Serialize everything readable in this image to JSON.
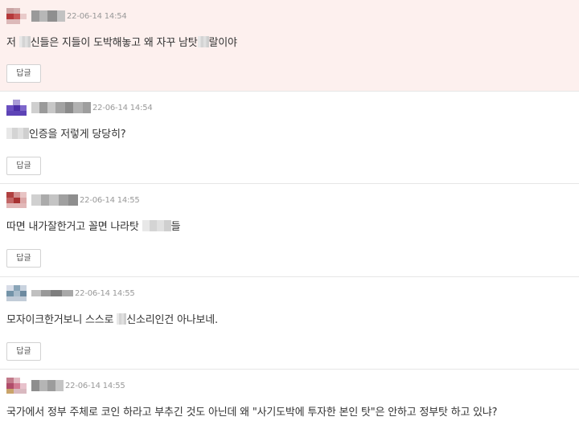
{
  "comments": [
    {
      "time": "22-06-14 14:54",
      "text_parts": [
        "저 ",
        "신들은 지들이 도박해놓고 왜 자꾸 남탓",
        "랄이야"
      ],
      "reply_label": "답글"
    },
    {
      "time": "22-06-14 14:54",
      "text_parts": [
        "",
        "인증을 저렇게 당당히?"
      ],
      "reply_label": "답글"
    },
    {
      "time": "22-06-14 14:55",
      "text_parts": [
        "따면 내가잘한거고 꼴면 나라탓 ",
        "들"
      ],
      "reply_label": "답글"
    },
    {
      "time": "22-06-14 14:55",
      "text_parts": [
        "모자이크한거보니 스스로 ",
        "신소리인건 아나보네."
      ],
      "reply_label": "답글"
    },
    {
      "time": "22-06-14 14:55",
      "text_parts": [
        "국가에서 정부 주체로 코인 하라고 부추긴 것도 아닌데 왜 \"사기도박에 투자한 본인 탓\"은 안하고 정부탓 하고 있냐?"
      ]
    }
  ]
}
